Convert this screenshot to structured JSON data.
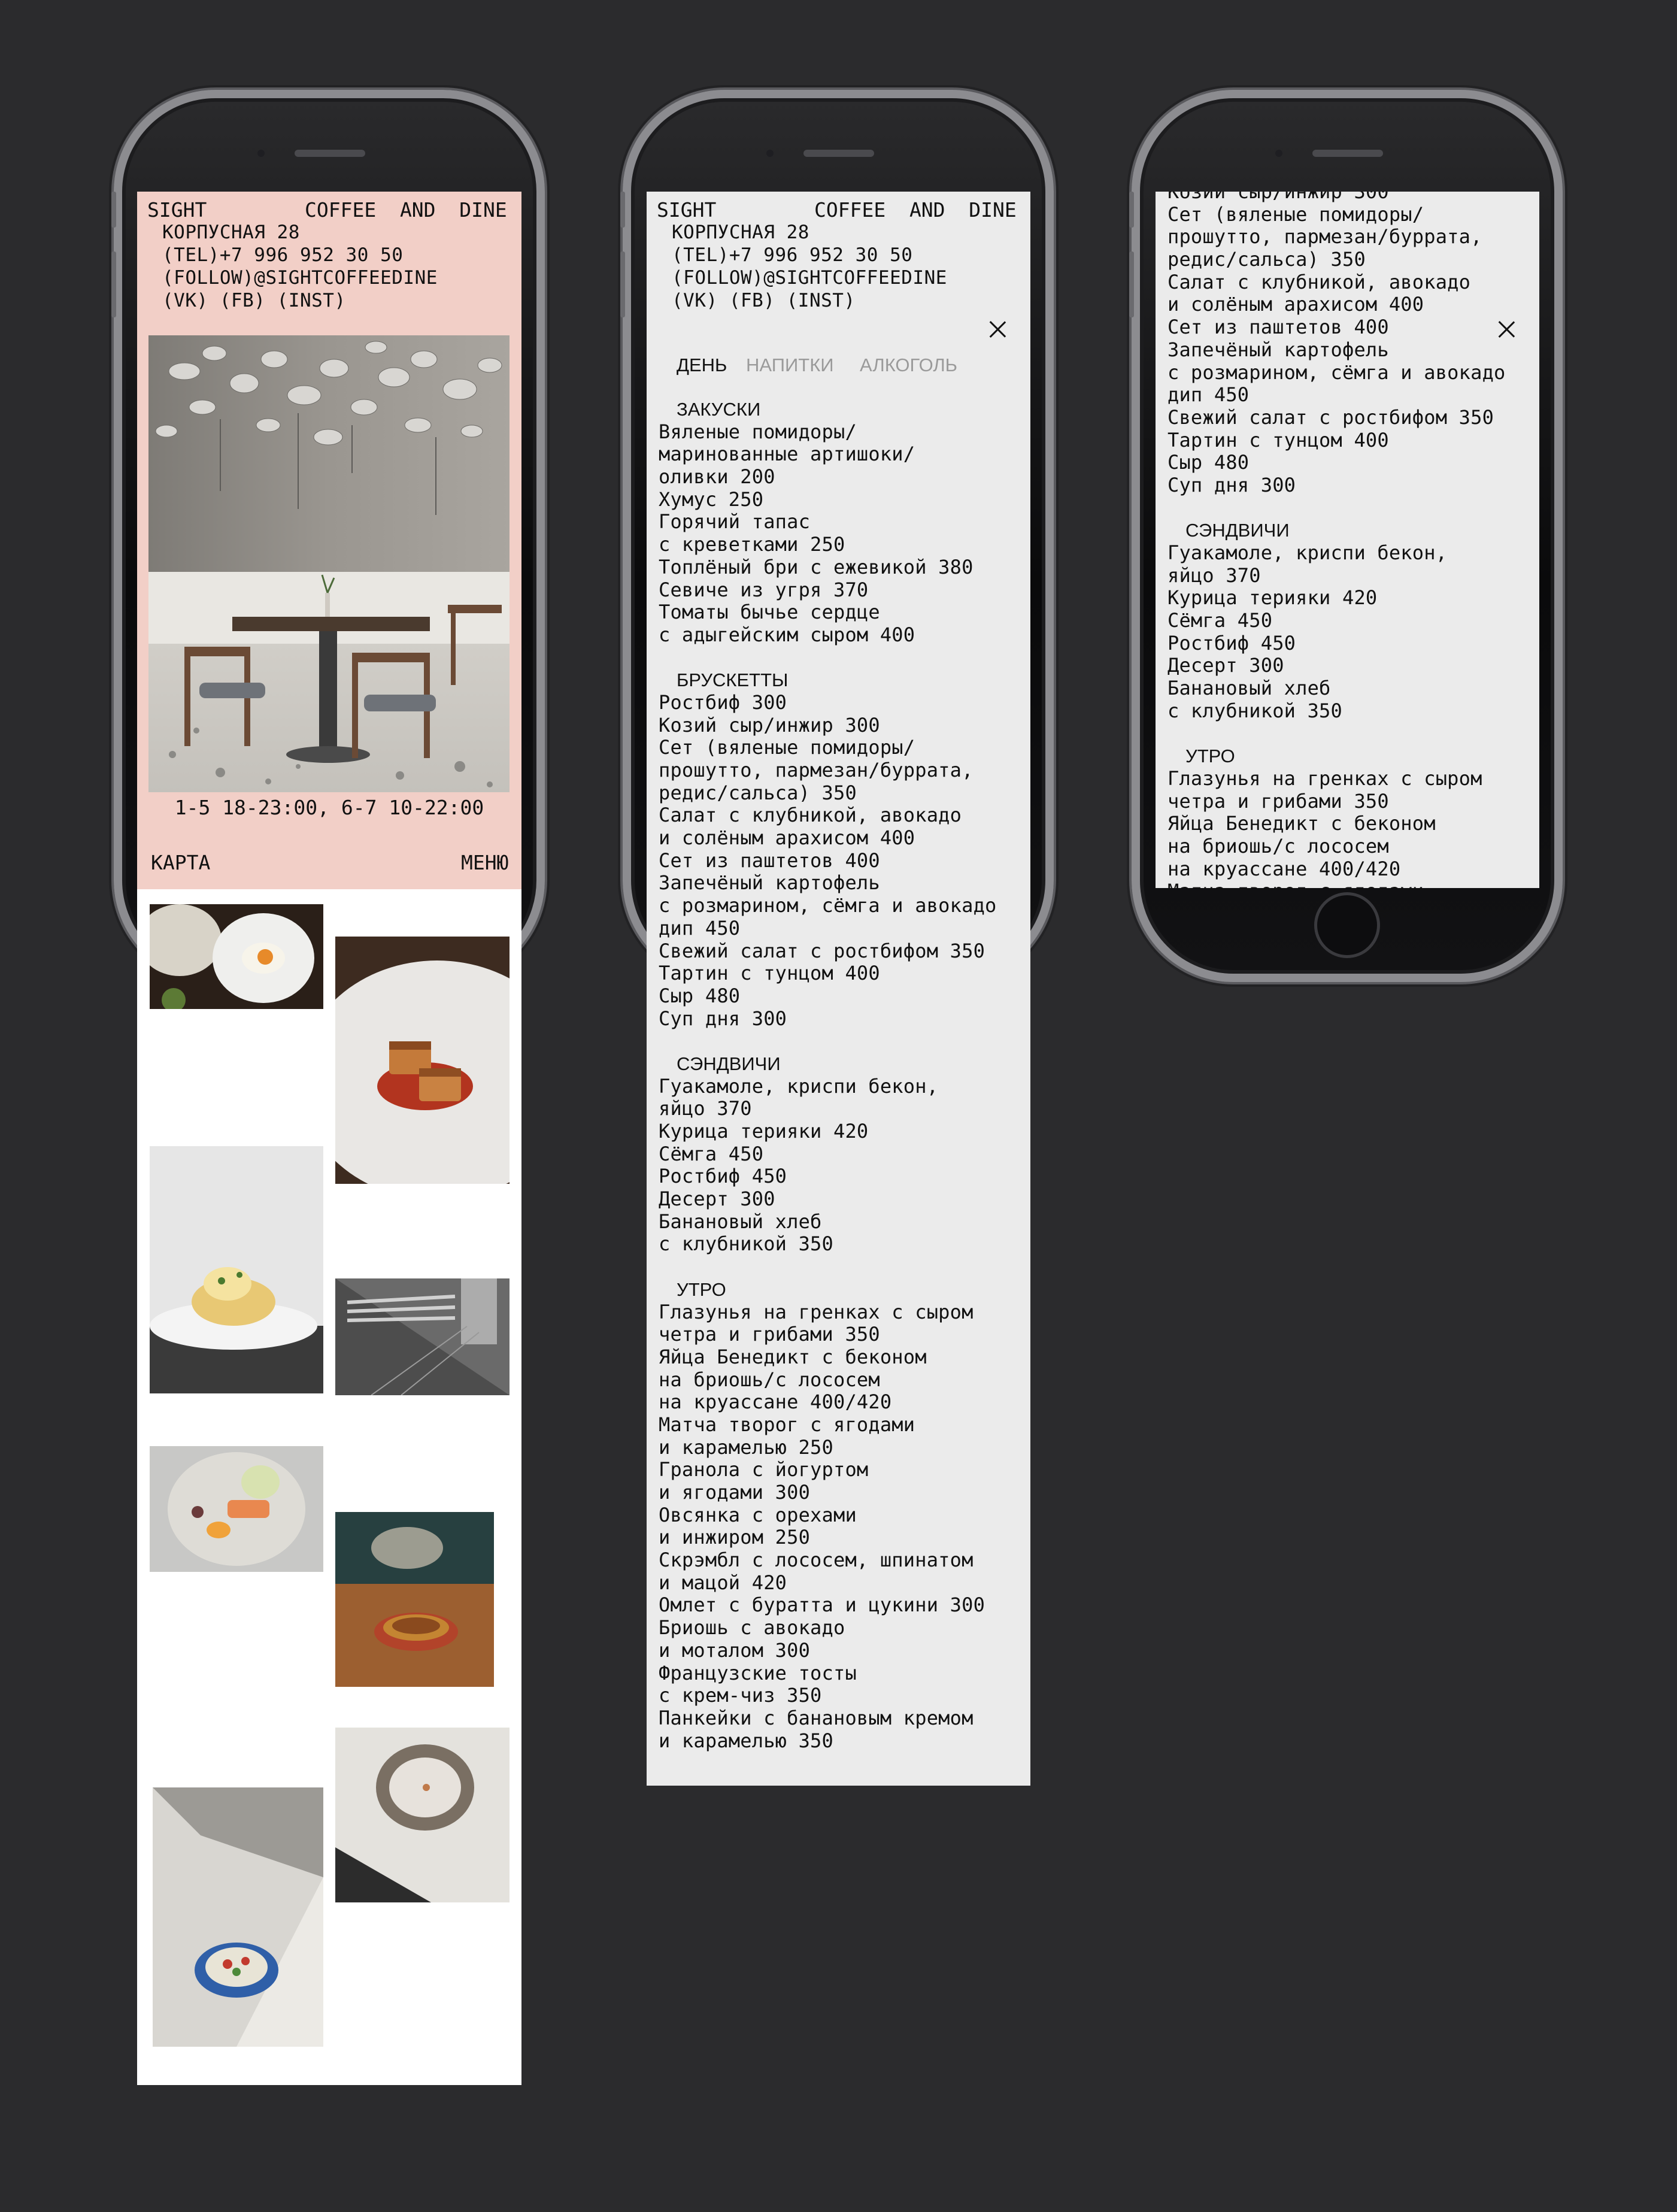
{
  "brand": {
    "left": "SIGHT",
    "right": "COFFEE  AND  DINE"
  },
  "contact": {
    "address": "КОРПУСНАЯ 28",
    "phone": "(TEL)+7 996 952 30 50",
    "follow": "(FOLLOW)@SIGHTCOFFEEDINE",
    "social": "(VK) (FB) (INST)"
  },
  "hours": "1-5 18-23:00, 6-7 10-22:00",
  "nav": {
    "map": "КАРТА",
    "menu": "МЕНЮ"
  },
  "tabs": [
    {
      "label": "ДЕНЬ",
      "active": true
    },
    {
      "label": "НАПИТКИ",
      "active": false
    },
    {
      "label": "АЛКОГОЛЬ",
      "active": false
    }
  ],
  "menu": {
    "zakuski_title": "ЗАКУСКИ",
    "zakuski": [
      "Вяленые помидоры/",
      "маринованные артишоки/",
      "оливки 200",
      "Хумус 250",
      "Горячий тапас",
      "с креветками 250",
      "Топлёный бри с ежевикой 380",
      "Севиче из угря 370",
      "Томаты бычье сердце",
      "с адыгейским сыром 400"
    ],
    "bruschetta_title": "БРУСКЕТТЫ",
    "bruschetta": [
      "Ростбиф 300",
      "Козий сыр/инжир 300",
      "Сет (вяленые помидоры/",
      "прошутто, пармезан/буррата,",
      "редис/сальса) 350",
      "Салат с клубникой, авокадо",
      "и солёным арахисом 400",
      "Сет из паштетов 400",
      "Запечёный картофель",
      "с розмарином, сёмга и авокадо",
      "дип 450",
      "Свежий салат с ростбифом 350",
      "Тартин с тунцом 400",
      "Сыр 480",
      "Суп дня 300"
    ],
    "sandwich_title": "СЭНДВИЧИ",
    "sandwiches": [
      "Гуакамоле, криспи бекон,",
      "яйцо 370",
      "Курица терияки 420",
      "Сёмга 450",
      "Ростбиф 450",
      "Десерт 300",
      "Банановый хлеб",
      "с клубникой 350"
    ],
    "morning_title": "УТРО",
    "morning": [
      "Глазунья на гренках с сыром",
      "четра и грибами 350",
      "Яйца Бенедикт с беконом",
      "на бриошь/с лососем",
      "на круассане 400/420",
      "Матча творог с ягодами",
      "и карамелью 250",
      "Гранола с йогуртом",
      "и ягодами 300",
      "Овсянка с орехами",
      "и инжиром 250",
      "Скрэмбл с лососем, шпинатом",
      "и мацой 420",
      "Омлет с буратта и цукини 300",
      "Бриошь с авокадо",
      "и моталом 300",
      "Французские тосты",
      "с крем-чиз 350",
      "Панкейки с банановым кремом",
      "и карамелью 350"
    ]
  },
  "colors": {
    "background": "#2b2b2d",
    "pink_screen": "#f2cfc7",
    "menu_screen": "#ebebeb",
    "inactive_tab": "#9a9a9a"
  },
  "icons": [
    "close-icon",
    "home-button"
  ]
}
